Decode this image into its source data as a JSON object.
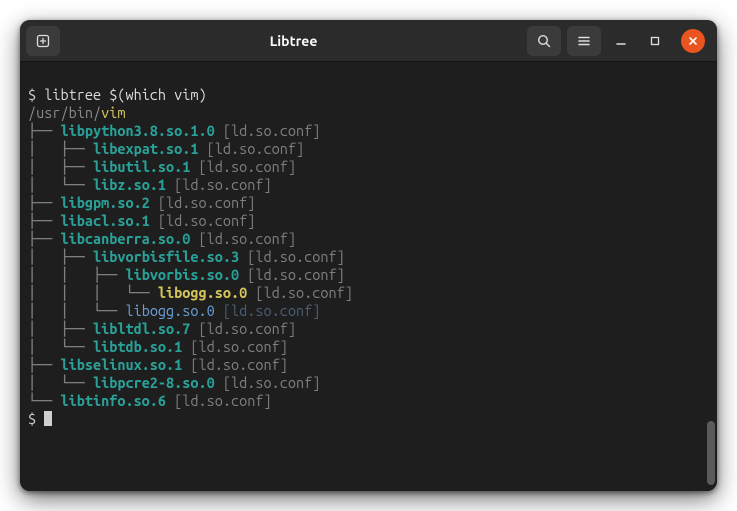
{
  "window": {
    "title": "Libtree"
  },
  "terminal": {
    "prompt": "$ ",
    "command": "libtree $(which vim)",
    "root_dir": "/usr/bin/",
    "root_target": "vim",
    "conf_tag": " [ld.so.conf]",
    "tree": [
      {
        "prefix": "├── ",
        "name": "libpython3.8.so.1.0",
        "style": "lib",
        "conf": "conf"
      },
      {
        "prefix": "│   ├── ",
        "name": "libexpat.so.1",
        "style": "lib",
        "conf": "conf"
      },
      {
        "prefix": "│   ├── ",
        "name": "libutil.so.1",
        "style": "lib",
        "conf": "conf"
      },
      {
        "prefix": "│   └── ",
        "name": "libz.so.1",
        "style": "lib",
        "conf": "conf"
      },
      {
        "prefix": "├── ",
        "name": "libgpm.so.2",
        "style": "lib",
        "conf": "conf"
      },
      {
        "prefix": "├── ",
        "name": "libacl.so.1",
        "style": "lib",
        "conf": "conf"
      },
      {
        "prefix": "├── ",
        "name": "libcanberra.so.0",
        "style": "lib",
        "conf": "conf"
      },
      {
        "prefix": "│   ├── ",
        "name": "libvorbisfile.so.3",
        "style": "lib",
        "conf": "conf"
      },
      {
        "prefix": "│   │   ├── ",
        "name": "libvorbis.so.0",
        "style": "lib",
        "conf": "conf"
      },
      {
        "prefix": "│   │   │   └── ",
        "name": "libogg.so.0",
        "style": "lib-leaf",
        "conf": "conf"
      },
      {
        "prefix": "│   │   └── ",
        "name": "libogg.so.0",
        "style": "lib-dim",
        "conf": "conf-dim"
      },
      {
        "prefix": "│   ├── ",
        "name": "libltdl.so.7",
        "style": "lib",
        "conf": "conf"
      },
      {
        "prefix": "│   └── ",
        "name": "libtdb.so.1",
        "style": "lib",
        "conf": "conf"
      },
      {
        "prefix": "├── ",
        "name": "libselinux.so.1",
        "style": "lib",
        "conf": "conf"
      },
      {
        "prefix": "│   └── ",
        "name": "libpcre2-8.so.0",
        "style": "lib",
        "conf": "conf"
      },
      {
        "prefix": "└── ",
        "name": "libtinfo.so.6",
        "style": "lib",
        "conf": "conf"
      }
    ]
  }
}
